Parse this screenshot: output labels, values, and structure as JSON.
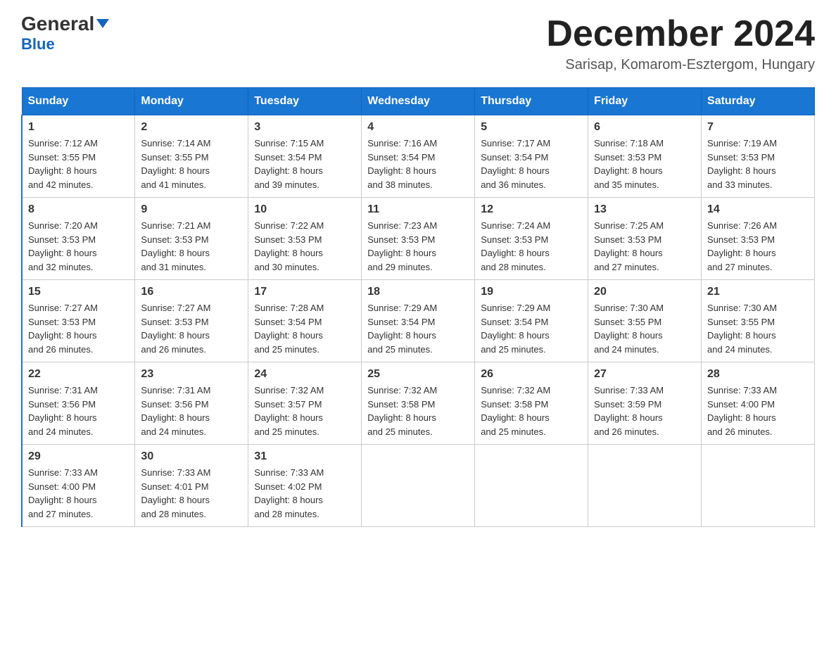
{
  "header": {
    "logo_general": "General",
    "logo_blue": "Blue",
    "month_title": "December 2024",
    "location": "Sarisap, Komarom-Esztergom, Hungary"
  },
  "days_of_week": [
    "Sunday",
    "Monday",
    "Tuesday",
    "Wednesday",
    "Thursday",
    "Friday",
    "Saturday"
  ],
  "weeks": [
    [
      {
        "day": "1",
        "sunrise": "7:12 AM",
        "sunset": "3:55 PM",
        "daylight": "8 hours and 42 minutes."
      },
      {
        "day": "2",
        "sunrise": "7:14 AM",
        "sunset": "3:55 PM",
        "daylight": "8 hours and 41 minutes."
      },
      {
        "day": "3",
        "sunrise": "7:15 AM",
        "sunset": "3:54 PM",
        "daylight": "8 hours and 39 minutes."
      },
      {
        "day": "4",
        "sunrise": "7:16 AM",
        "sunset": "3:54 PM",
        "daylight": "8 hours and 38 minutes."
      },
      {
        "day": "5",
        "sunrise": "7:17 AM",
        "sunset": "3:54 PM",
        "daylight": "8 hours and 36 minutes."
      },
      {
        "day": "6",
        "sunrise": "7:18 AM",
        "sunset": "3:53 PM",
        "daylight": "8 hours and 35 minutes."
      },
      {
        "day": "7",
        "sunrise": "7:19 AM",
        "sunset": "3:53 PM",
        "daylight": "8 hours and 33 minutes."
      }
    ],
    [
      {
        "day": "8",
        "sunrise": "7:20 AM",
        "sunset": "3:53 PM",
        "daylight": "8 hours and 32 minutes."
      },
      {
        "day": "9",
        "sunrise": "7:21 AM",
        "sunset": "3:53 PM",
        "daylight": "8 hours and 31 minutes."
      },
      {
        "day": "10",
        "sunrise": "7:22 AM",
        "sunset": "3:53 PM",
        "daylight": "8 hours and 30 minutes."
      },
      {
        "day": "11",
        "sunrise": "7:23 AM",
        "sunset": "3:53 PM",
        "daylight": "8 hours and 29 minutes."
      },
      {
        "day": "12",
        "sunrise": "7:24 AM",
        "sunset": "3:53 PM",
        "daylight": "8 hours and 28 minutes."
      },
      {
        "day": "13",
        "sunrise": "7:25 AM",
        "sunset": "3:53 PM",
        "daylight": "8 hours and 27 minutes."
      },
      {
        "day": "14",
        "sunrise": "7:26 AM",
        "sunset": "3:53 PM",
        "daylight": "8 hours and 27 minutes."
      }
    ],
    [
      {
        "day": "15",
        "sunrise": "7:27 AM",
        "sunset": "3:53 PM",
        "daylight": "8 hours and 26 minutes."
      },
      {
        "day": "16",
        "sunrise": "7:27 AM",
        "sunset": "3:53 PM",
        "daylight": "8 hours and 26 minutes."
      },
      {
        "day": "17",
        "sunrise": "7:28 AM",
        "sunset": "3:54 PM",
        "daylight": "8 hours and 25 minutes."
      },
      {
        "day": "18",
        "sunrise": "7:29 AM",
        "sunset": "3:54 PM",
        "daylight": "8 hours and 25 minutes."
      },
      {
        "day": "19",
        "sunrise": "7:29 AM",
        "sunset": "3:54 PM",
        "daylight": "8 hours and 25 minutes."
      },
      {
        "day": "20",
        "sunrise": "7:30 AM",
        "sunset": "3:55 PM",
        "daylight": "8 hours and 24 minutes."
      },
      {
        "day": "21",
        "sunrise": "7:30 AM",
        "sunset": "3:55 PM",
        "daylight": "8 hours and 24 minutes."
      }
    ],
    [
      {
        "day": "22",
        "sunrise": "7:31 AM",
        "sunset": "3:56 PM",
        "daylight": "8 hours and 24 minutes."
      },
      {
        "day": "23",
        "sunrise": "7:31 AM",
        "sunset": "3:56 PM",
        "daylight": "8 hours and 24 minutes."
      },
      {
        "day": "24",
        "sunrise": "7:32 AM",
        "sunset": "3:57 PM",
        "daylight": "8 hours and 25 minutes."
      },
      {
        "day": "25",
        "sunrise": "7:32 AM",
        "sunset": "3:58 PM",
        "daylight": "8 hours and 25 minutes."
      },
      {
        "day": "26",
        "sunrise": "7:32 AM",
        "sunset": "3:58 PM",
        "daylight": "8 hours and 25 minutes."
      },
      {
        "day": "27",
        "sunrise": "7:33 AM",
        "sunset": "3:59 PM",
        "daylight": "8 hours and 26 minutes."
      },
      {
        "day": "28",
        "sunrise": "7:33 AM",
        "sunset": "4:00 PM",
        "daylight": "8 hours and 26 minutes."
      }
    ],
    [
      {
        "day": "29",
        "sunrise": "7:33 AM",
        "sunset": "4:00 PM",
        "daylight": "8 hours and 27 minutes."
      },
      {
        "day": "30",
        "sunrise": "7:33 AM",
        "sunset": "4:01 PM",
        "daylight": "8 hours and 28 minutes."
      },
      {
        "day": "31",
        "sunrise": "7:33 AM",
        "sunset": "4:02 PM",
        "daylight": "8 hours and 28 minutes."
      },
      null,
      null,
      null,
      null
    ]
  ],
  "labels": {
    "sunrise": "Sunrise:",
    "sunset": "Sunset:",
    "daylight": "Daylight:"
  }
}
